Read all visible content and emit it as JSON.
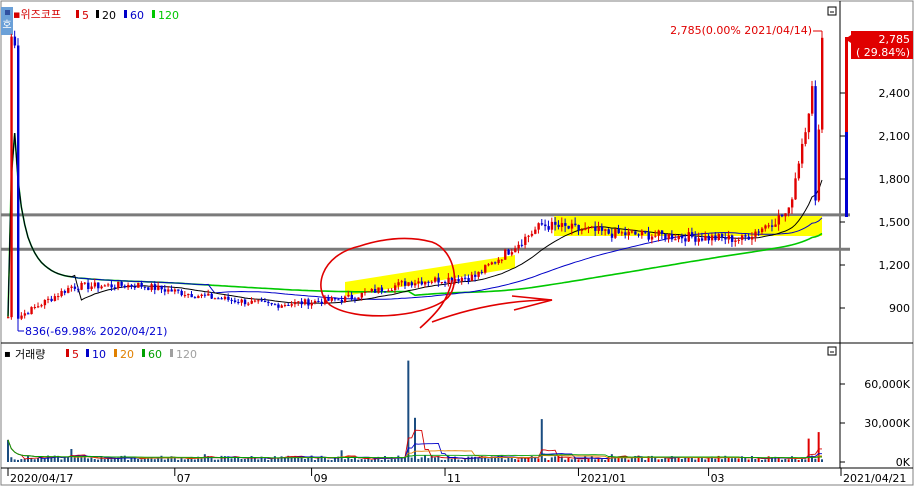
{
  "price_panel": {
    "tab_icon_label": "호",
    "stock_name": "위즈코프",
    "ma_legend": [
      {
        "label": "5",
        "color": "#d40000"
      },
      {
        "label": "20",
        "color": "#000000"
      },
      {
        "label": "60",
        "color": "#0000c8"
      },
      {
        "label": "120",
        "color": "#00c800"
      }
    ],
    "high_annotation": "2,785(0.00% 2021/04/14)",
    "low_annotation": "836(-69.98% 2020/04/21)",
    "last_price_tag": "2,785",
    "last_change_tag": "( 29.84%)"
  },
  "volume_panel": {
    "title": "거래량",
    "ma_legend": [
      {
        "label": "5",
        "color": "#d40000"
      },
      {
        "label": "10",
        "color": "#0000c8"
      },
      {
        "label": "20",
        "color": "#e08000"
      },
      {
        "label": "60",
        "color": "#00a000"
      },
      {
        "label": "120",
        "color": "#a0a0a0"
      }
    ]
  },
  "x_axis": {
    "ticks": [
      "2020/04/17",
      "07",
      "09",
      "11",
      "2021/01",
      "03",
      "2021/04/21"
    ]
  },
  "chart_data": [
    {
      "type": "candlestick",
      "title": "위즈코프",
      "xlabel": "",
      "ylabel": "",
      "ylim": [
        700,
        2900
      ],
      "y_ticks": [
        "2,400",
        "2,100",
        "1,800",
        "1,500",
        "1,200",
        "900"
      ],
      "y_tick_values": [
        2400,
        2100,
        1800,
        1500,
        1200,
        900
      ],
      "grid": false,
      "horizontal_levels": [
        1550,
        1310
      ],
      "last_price": 2785,
      "high": {
        "value": 2785,
        "date": "2021/04/14"
      },
      "low": {
        "value": 836,
        "date": "2020/04/21"
      },
      "series_close_approx": [
        {
          "date": "2020/04/21",
          "value": 836
        },
        {
          "date": "2020/05",
          "value": 1050
        },
        {
          "date": "2020/06",
          "value": 1060
        },
        {
          "date": "2020/07",
          "value": 980
        },
        {
          "date": "2020/08",
          "value": 920
        },
        {
          "date": "2020/09",
          "value": 960
        },
        {
          "date": "2020/10",
          "value": 1080
        },
        {
          "date": "2020/11",
          "value": 1120
        },
        {
          "date": "2020/12",
          "value": 1480
        },
        {
          "date": "2021/01",
          "value": 1420
        },
        {
          "date": "2021/02",
          "value": 1400
        },
        {
          "date": "2021/03",
          "value": 1380
        },
        {
          "date": "2021/04/06",
          "value": 1570
        },
        {
          "date": "2021/04/21",
          "value": 2785
        }
      ]
    },
    {
      "type": "bar",
      "title": "거래량",
      "ylim": [
        0,
        88000
      ],
      "y_ticks": [
        "60,000K",
        "30,000K",
        "0K"
      ],
      "y_tick_values": [
        60000,
        30000,
        0
      ],
      "spikes": [
        {
          "date": "2020/04",
          "value": 17000
        },
        {
          "date": "2020/05",
          "value": 10000
        },
        {
          "date": "2020/07",
          "value": 6000
        },
        {
          "date": "2020/09",
          "value": 9000
        },
        {
          "date": "2020/10",
          "value": 78000
        },
        {
          "date": "2020/10",
          "value": 34000
        },
        {
          "date": "2020/12",
          "value": 33000
        },
        {
          "date": "2021/01",
          "value": 6000
        },
        {
          "date": "2021/04",
          "value": 18000
        },
        {
          "date": "2021/04",
          "value": 23000
        }
      ]
    }
  ]
}
